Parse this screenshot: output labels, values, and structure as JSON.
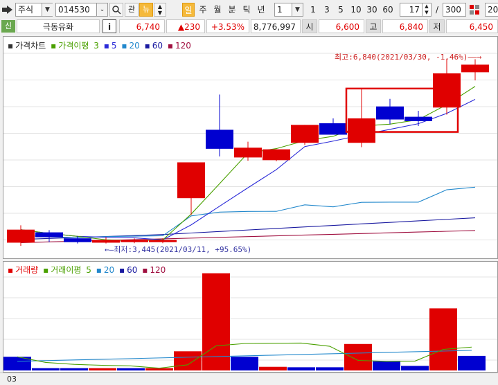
{
  "toolbar": {
    "market": "주식",
    "code": "014530",
    "btn_gwan": "관",
    "btn_new": "뉴",
    "periods": [
      "일",
      "주",
      "월",
      "분",
      "틱",
      "년"
    ],
    "period_count": "1",
    "intervals": [
      "1",
      "3",
      "5",
      "10",
      "30",
      "60"
    ],
    "page_current": "17",
    "page_sep": "/",
    "page_total": "300",
    "right_edge": "20"
  },
  "info": {
    "badge": "신",
    "name": "극동유화",
    "info_btn": "i",
    "price": "6,740",
    "change": "▲230",
    "change_pct": "+3.53%",
    "volume": "8,776,997",
    "open_label": "시",
    "open": "6,600",
    "high_label": "고",
    "high": "6,840",
    "low_label": "저",
    "low": "6,450"
  },
  "price_panel": {
    "legend_title": "가격차트",
    "legend_ma_label": "가격이평",
    "legend_items": [
      "3",
      "5",
      "20",
      "60",
      "120"
    ],
    "high_note": "최고:6,840(2021/03/30, -1.46%)",
    "low_note": "최저:3,445(2021/03/11, +95.65%)"
  },
  "volume_panel": {
    "legend_title": "거래량",
    "legend_ma_label": "거래이평",
    "legend_items": [
      "5",
      "20",
      "60",
      "120"
    ]
  },
  "status": {
    "text": "03"
  },
  "colors": {
    "up": "#e00000",
    "down": "#0000d0",
    "ma3": "#4aa000",
    "ma5": "#2a2ad8",
    "ma20": "#2288cc",
    "ma60": "#1a1aa0",
    "ma120": "#a01040",
    "accent": "#f0a020"
  },
  "chart_data": [
    {
      "type": "candlestick",
      "title": "가격차트",
      "candles": [
        {
          "open": 3460,
          "close": 3700,
          "high": 3780,
          "low": 3400
        },
        {
          "open": 3650,
          "close": 3560,
          "high": 3690,
          "low": 3470
        },
        {
          "open": 3540,
          "close": 3470,
          "high": 3580,
          "low": 3445
        },
        {
          "open": 3460,
          "close": 3510,
          "high": 3560,
          "low": 3445
        },
        {
          "open": 3470,
          "close": 3510,
          "high": 3540,
          "low": 3450
        },
        {
          "open": 3470,
          "close": 3510,
          "high": 3540,
          "low": 3450
        },
        {
          "open": 4280,
          "close": 4940,
          "high": 4940,
          "low": 3970
        },
        {
          "open": 5540,
          "close": 5190,
          "high": 6190,
          "low": 5050
        },
        {
          "open": 5030,
          "close": 5210,
          "high": 5320,
          "low": 4970
        },
        {
          "open": 4980,
          "close": 5180,
          "high": 5180,
          "low": 4960
        },
        {
          "open": 5300,
          "close": 5630,
          "high": 5630,
          "low": 5260
        },
        {
          "open": 5660,
          "close": 5450,
          "high": 5750,
          "low": 5450
        },
        {
          "open": 5300,
          "close": 5750,
          "high": 6310,
          "low": 5220
        },
        {
          "open": 5970,
          "close": 5730,
          "high": 6110,
          "low": 5640
        },
        {
          "open": 5780,
          "close": 5700,
          "high": 5890,
          "low": 5610
        },
        {
          "open": 5950,
          "close": 6580,
          "high": 6850,
          "low": 5820
        },
        {
          "open": 6600,
          "close": 6740,
          "high": 6840,
          "low": 6450
        }
      ],
      "ylim": [
        3300,
        7000
      ]
    },
    {
      "type": "bar",
      "title": "거래량",
      "values": [
        3,
        0.5,
        0.5,
        0.5,
        0.5,
        0.5,
        4.2,
        21.3,
        3,
        0.8,
        0.7,
        0.7,
        5.8,
        2,
        1,
        13.6,
        3.2
      ],
      "colors": [
        "down",
        "down",
        "down",
        "up",
        "down",
        "up",
        "up",
        "up",
        "down",
        "up",
        "down",
        "down",
        "up",
        "down",
        "down",
        "up",
        "down"
      ],
      "ylim": [
        0,
        22
      ]
    }
  ]
}
